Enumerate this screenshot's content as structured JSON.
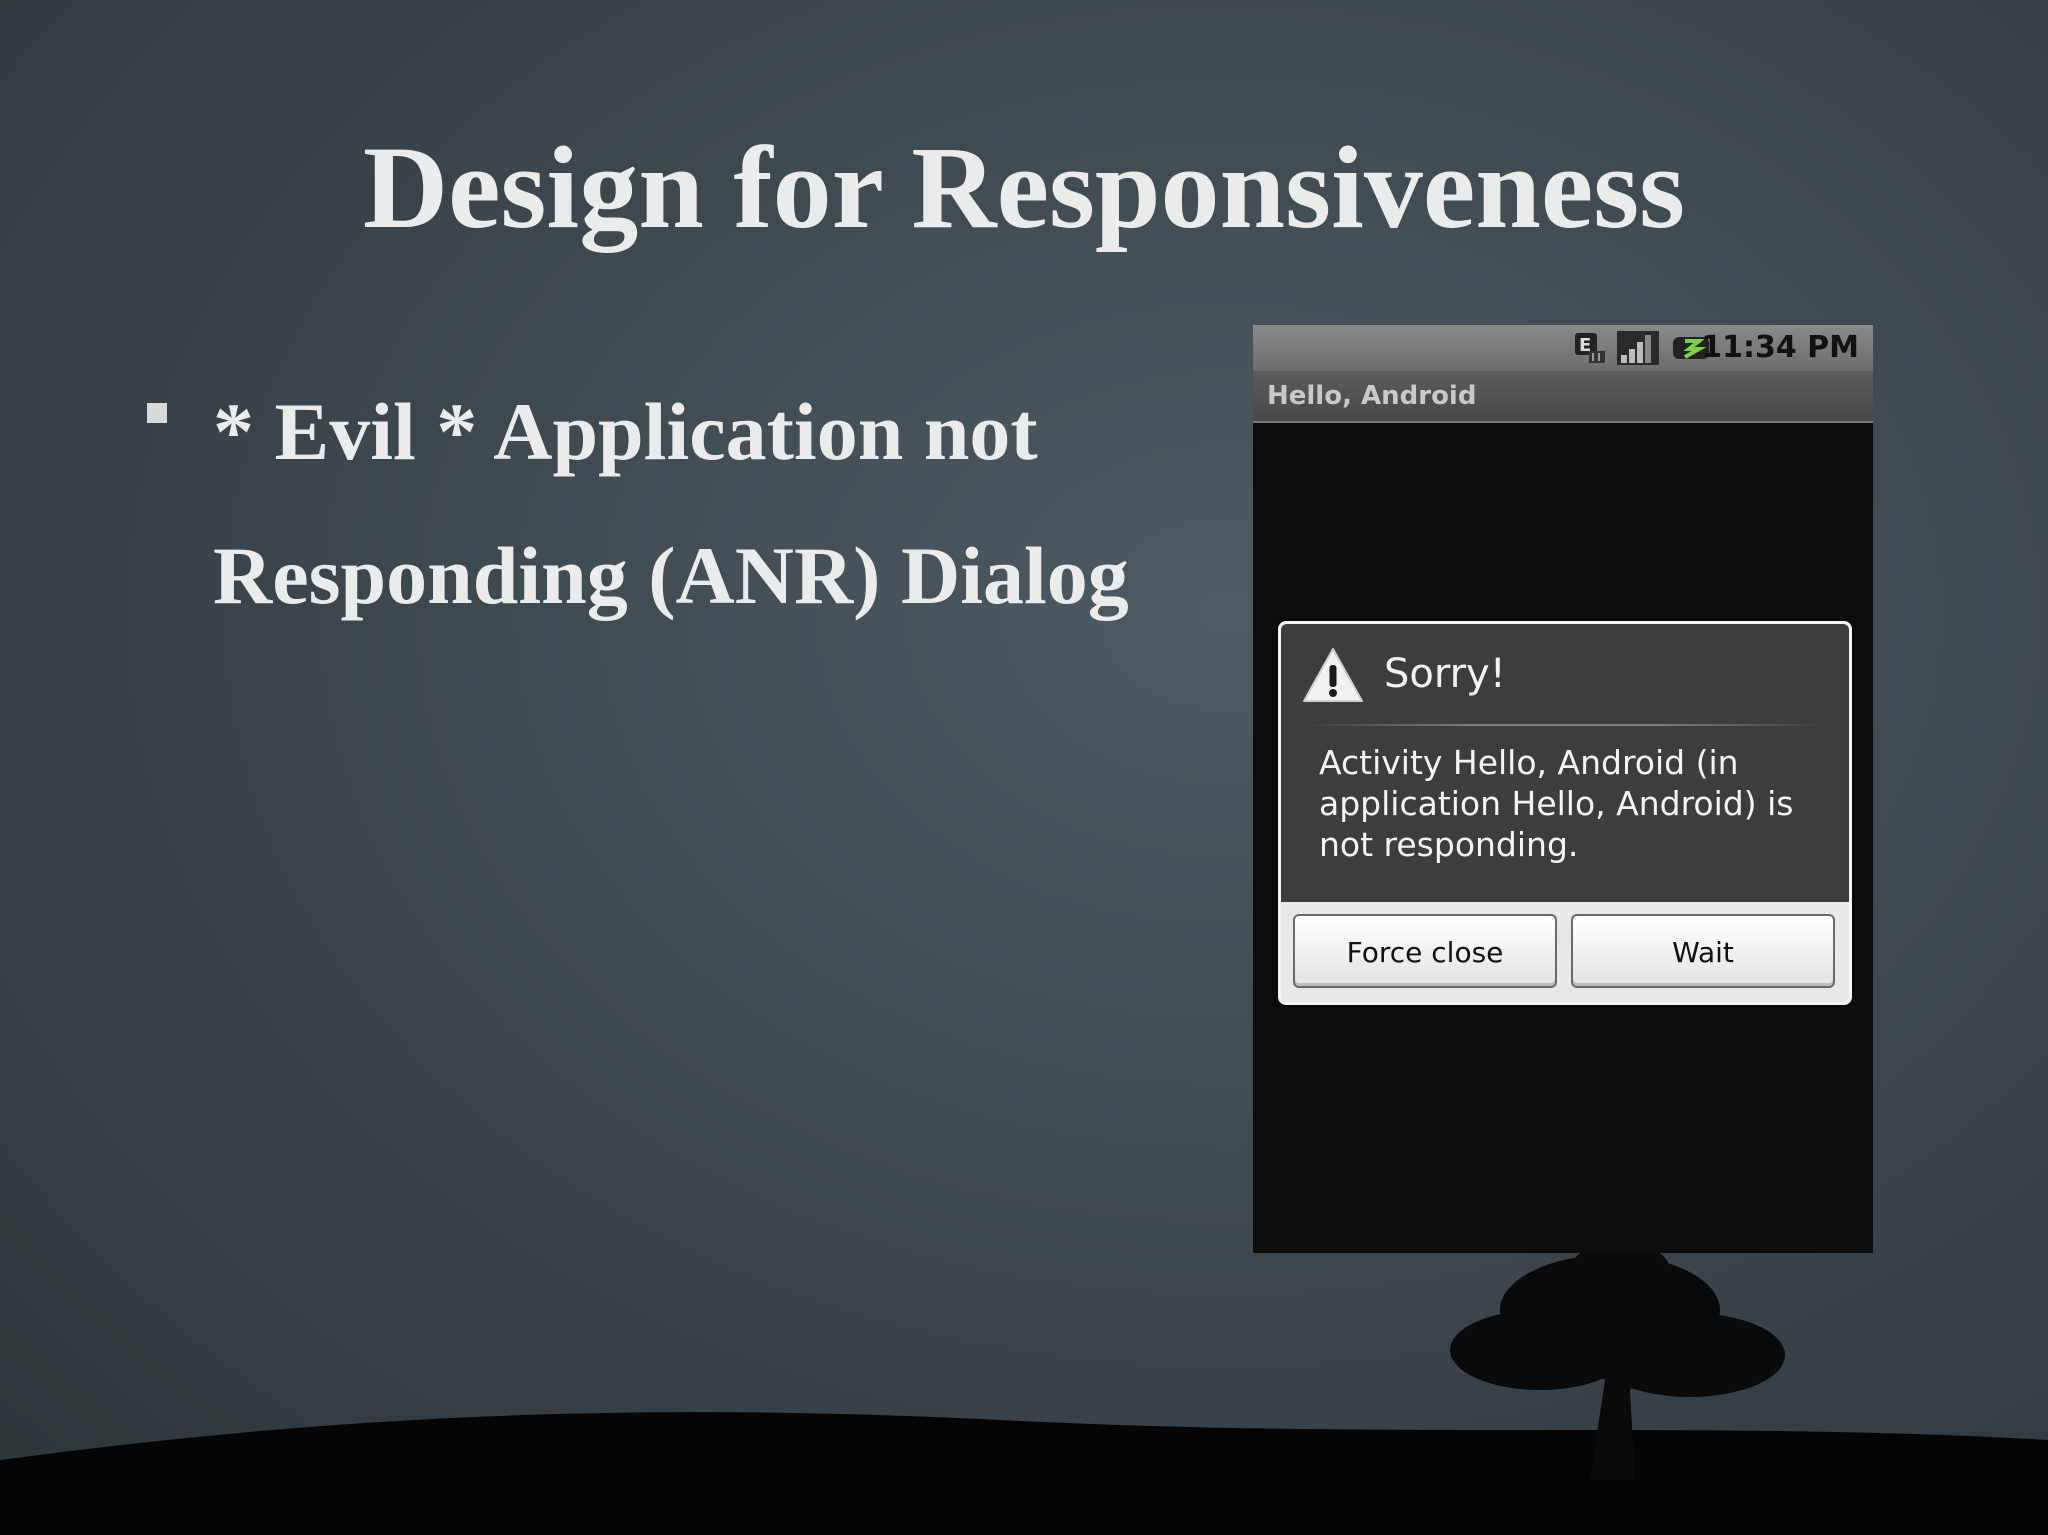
{
  "slide": {
    "title": "Design for Responsiveness",
    "bullet": "* Evil * Application not Responding (ANR) Dialog"
  },
  "phone": {
    "status_bar": {
      "time": "11:34 PM",
      "icons": [
        "edge-data-icon",
        "signal-bars-icon",
        "battery-icon"
      ]
    },
    "app_title": "Hello, Android",
    "dialog": {
      "icon": "warning-icon",
      "title": "Sorry!",
      "message": "Activity Hello, Android (in application Hello, Android) is not responding.",
      "buttons": {
        "force_close": "Force close",
        "wait": "Wait"
      }
    }
  },
  "colors": {
    "slide_background": "#3e484f",
    "title_text": "#ebebeb",
    "phone_background": "#0d0d0d",
    "dialog_body": "#3d3d3d"
  }
}
